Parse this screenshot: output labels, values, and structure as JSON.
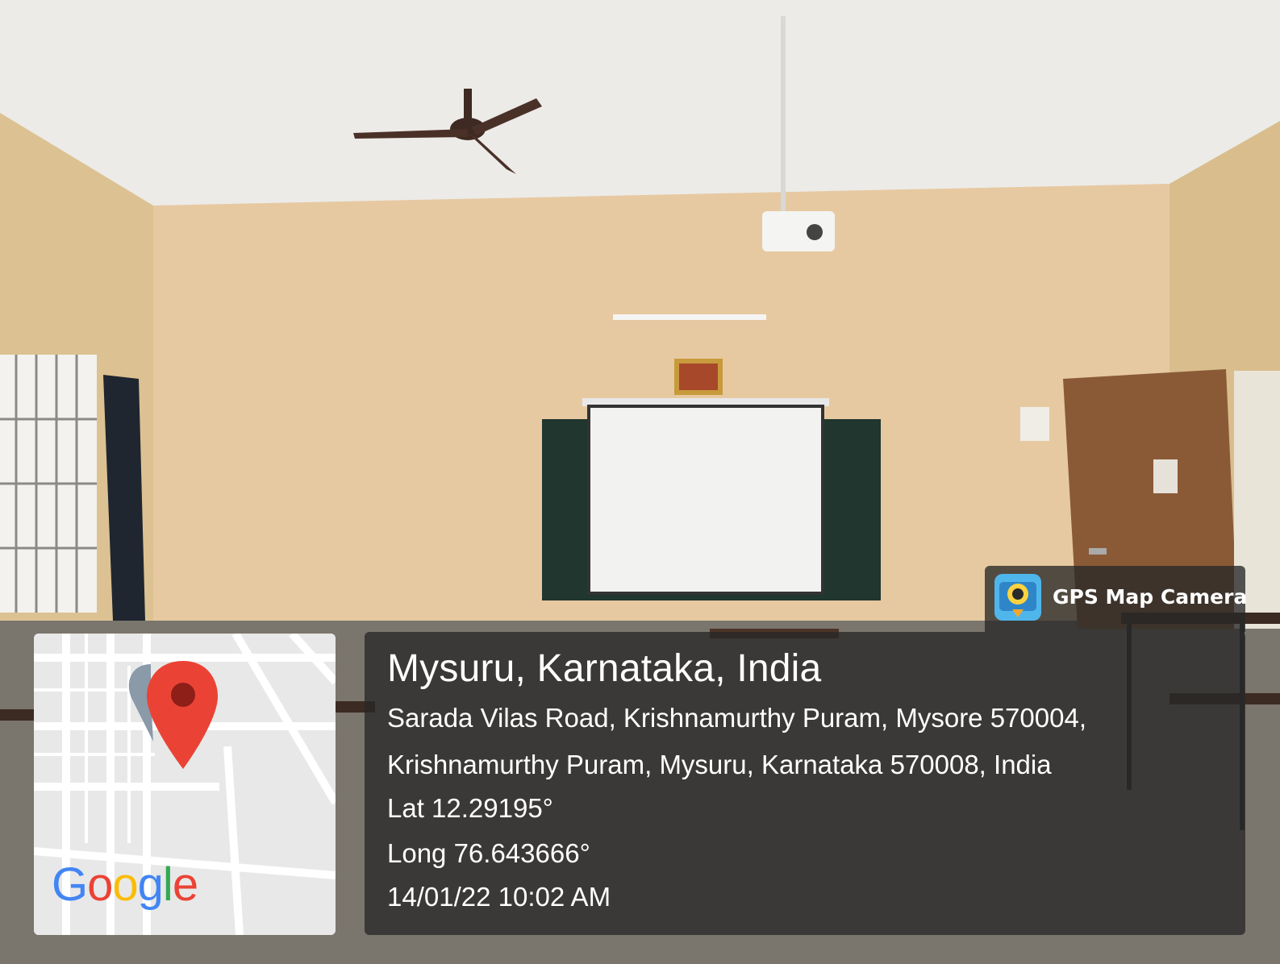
{
  "overlay": {
    "location_title": "Mysuru, Karnataka, India",
    "address_line1": "Sarada Vilas Road, Krishnamurthy Puram, Mysore 570004,",
    "address_line2": "Krishnamurthy Puram, Mysuru, Karnataka 570008, India",
    "latitude": "Lat 12.29195°",
    "longitude": "Long 76.643666°",
    "timestamp": "14/01/22 10:02 AM"
  },
  "brand": {
    "label": "GPS Map Camera",
    "icon": "gps-map-camera-app-icon"
  },
  "map": {
    "logo_letters": [
      "G",
      "o",
      "o",
      "g",
      "l",
      "e"
    ],
    "logo_colors": [
      "#4285F4",
      "#EA4335",
      "#FBBC05",
      "#4285F4",
      "#34A853",
      "#EA4335"
    ],
    "pin_color": "#EA4335"
  }
}
